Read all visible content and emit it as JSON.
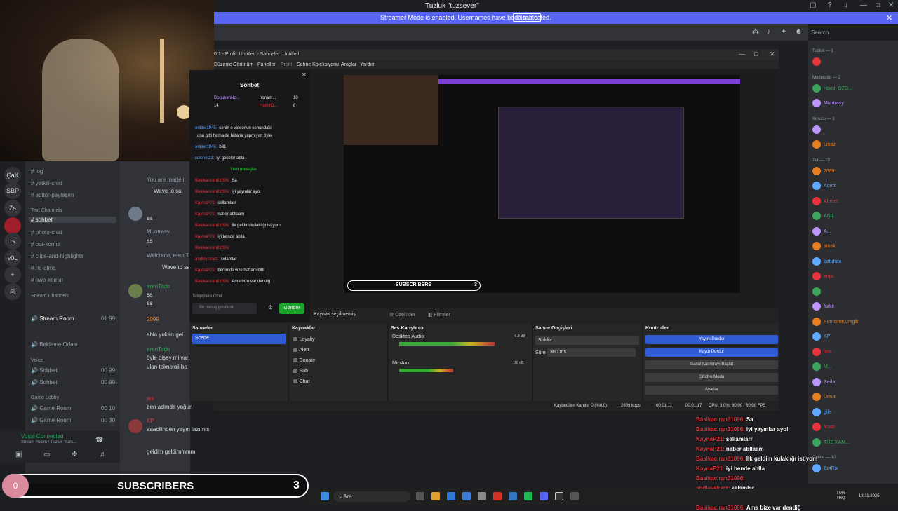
{
  "window": {
    "title": "Tuzluk \"tuzsever\""
  },
  "streamer_bar": {
    "message": "Streamer Mode is enabled. Usernames have been truncated.",
    "button": "Disable"
  },
  "search": {
    "placeholder": "Search"
  },
  "servers": [
    "ÇaK",
    "SBP",
    "Zs",
    "ts",
    "v0L"
  ],
  "channels": {
    "items_top": [
      "log",
      "yetkili-chat",
      "editör-paylaşım"
    ],
    "text_category": "Text Channels",
    "text_channels": [
      "sohbet",
      "photo-chat",
      "bot-komut",
      "clips-and-highlights",
      "rol-alma",
      "owo-komut"
    ],
    "stream_category": "Stream Channels",
    "stream_room": "Stream Room",
    "stream_room_counts": "01  99",
    "waiting_room": "Bekleme Odası",
    "voice_category": "Voice",
    "voice_channels": [
      "Sohbet",
      "Sohbet"
    ],
    "voice_counts": [
      "00  99",
      "00  99"
    ],
    "game_category": "Game Lobby",
    "game_rooms": [
      "Game Room",
      "Game Room"
    ],
    "game_counts": [
      "00  10",
      "00  30"
    ],
    "voice_connected": "Voice Connected",
    "voice_connected_sub": "Stream Room / Tuzluk \"tuzs..."
  },
  "discord_chat": [
    {
      "name": "",
      "text": "You are made it"
    },
    {
      "name": "",
      "text": "Wave to sa"
    },
    {
      "name": "",
      "text": "sa"
    },
    {
      "name": "Muntrasy",
      "text": "as"
    },
    {
      "name": "",
      "text": "Welcome, eren Ta"
    },
    {
      "name": "",
      "text": "Wave to sa"
    },
    {
      "name": "erenTado",
      "text": "sa"
    },
    {
      "name": "",
      "text": "as"
    },
    {
      "name": "2099",
      "text": "abla yukarı gel"
    },
    {
      "name": "erenTado",
      "text": "öyle bişey mi vardı"
    },
    {
      "name": "",
      "text": "ulan teknoloji ba"
    },
    {
      "name": "jes",
      "text": "ben aslında yoğun"
    },
    {
      "name": "KP",
      "text": "aaacilinden yayın lazımıs"
    },
    {
      "name": "",
      "text": "geldim geldimmmm"
    }
  ],
  "obs": {
    "title": "0.1 - Profil: Untitled - Sahneler: Untitled",
    "menu": [
      "Düzenle",
      "Görünüm",
      "Paneller",
      "Profil",
      "Sahne Koleksiyonu",
      "Araçlar",
      "Yardım"
    ],
    "no_source": "Kaynak seçilmemiş",
    "properties": "Özellikler",
    "filters": "Filtreler",
    "scenes_title": "Sahneler",
    "scenes": [
      "Scene"
    ],
    "sources_title": "Kaynaklar",
    "sources": [
      "Loyalty",
      "Alert",
      "Donate",
      "Sub",
      "Chat"
    ],
    "mixer_title": "Ses Karıştırıcı",
    "mixer": [
      {
        "name": "Desktop Audio",
        "db": "-6.8 dB",
        "level": 0.8
      },
      {
        "name": "Mic/Aux",
        "db": "0.0 dB",
        "level": 0.45
      }
    ],
    "transitions_title": "Sahne Geçişleri",
    "transition": "Soldur",
    "duration_label": "Süre",
    "duration": "300 ms",
    "controls_title": "Kontroller",
    "controls": [
      "Yayını Durdur",
      "Kaydı Durdur",
      "Sanal Kamerayı Başlat",
      "Stüdyo Modu",
      "Ayarlar"
    ],
    "status": {
      "dropped": "Kaybedilen Kareler 0 (%0.0)",
      "kbps": "2689 kbps",
      "rec": "00:01:11",
      "live": "00:01:17",
      "cpu": "CPU: 3.0%, 60.00 / 60.00 FPS"
    }
  },
  "twitch_chat": {
    "title": "Sohbet",
    "users": [
      "nonam...",
      "HamitO..."
    ],
    "counts": [
      "10",
      "8"
    ],
    "top_user": "DogukanNo...",
    "top_count": "14",
    "new_messages": "Yeni mesajlar",
    "lines": [
      {
        "user": "entine1945:",
        "text": "senin o videonun sonundaki",
        "cls": ""
      },
      {
        "user": "",
        "text": "una gitti herhalde bidaha yapmıyım öyle",
        "cls": ""
      },
      {
        "user": "entine1945:",
        "text": "b31",
        "cls": ""
      },
      {
        "user": "colonel22:",
        "text": "iyi geceler abla",
        "cls": ""
      },
      {
        "user": "Basikaciran31096:",
        "text": "Sa",
        "cls": "red"
      },
      {
        "user": "Basikaciran31096:",
        "text": "iyi yayınlar ayol",
        "cls": "red"
      },
      {
        "user": "KaynaP21:",
        "text": "sellamlarr",
        "cls": "red"
      },
      {
        "user": "KaynaP21:",
        "text": "naber abllaam",
        "cls": "red"
      },
      {
        "user": "Basikaciran31096:",
        "text": "İlk geldim kulaklığı istiyom",
        "cls": "red"
      },
      {
        "user": "KaynaP21:",
        "text": "iyi bende ablla",
        "cls": "red"
      },
      {
        "user": "Basikaciran31096:",
        "text": "",
        "cls": "red"
      },
      {
        "user": "andleyskarz:",
        "text": "selamlar",
        "cls": "red"
      },
      {
        "user": "KaynaP21:",
        "text": "benimde vize haftam bitti",
        "cls": "red"
      },
      {
        "user": "Basikaciran31096:",
        "text": "Ama bize var dendiğ",
        "cls": "red"
      }
    ],
    "followers": "Takipçilere Özel",
    "input_placeholder": "Bir mesaj gönderin",
    "send": "Gönder"
  },
  "members": {
    "groups": [
      {
        "title": "Tuzluk — 1",
        "names": [
          ""
        ]
      },
      {
        "title": "Moderatör — 2",
        "names": [
          "Hamit ÖZG...",
          "Muntrasy"
        ]
      },
      {
        "title": "Kurucu — 2",
        "names": [
          "",
          "Lmaz"
        ]
      },
      {
        "title": "Tur — 19",
        "names": [
          "2099",
          "Adem",
          "Ahmet",
          "ANIL",
          "A...",
          "atoski",
          "batuhan",
          "enjin",
          "",
          "furkii",
          "FırıncımKüregili",
          "KP",
          "lost",
          "M...",
          "Sedat",
          "Umut",
          "gile",
          "Yuso",
          "THE KAM..."
        ]
      },
      {
        "title": "Online — 12",
        "names": [
          "BotRix"
        ]
      }
    ]
  },
  "overlay_chat": [
    {
      "user": "Basikaciran31096:",
      "text": "Sa"
    },
    {
      "user": "Basikaciran31096:",
      "text": "iyi yayınlar ayol"
    },
    {
      "user": "KaynaP21:",
      "text": "sellamlarr"
    },
    {
      "user": "KaynaP21:",
      "text": "naber abllaam"
    },
    {
      "user": "Basikaciran31096:",
      "text": "İlk geldim kulaklığı istiyom"
    },
    {
      "user": "KaynaP21:",
      "text": "iyi bende ablla"
    },
    {
      "user": "Basikaciran31096:",
      "text": ""
    },
    {
      "user": "andleyskarz:",
      "text": "selamlar"
    },
    {
      "user": "KaynaP21:",
      "text": "benimde vize haftam bitti"
    },
    {
      "user": "Basikaciran31096:",
      "text": "Ama bize var dendiğ"
    }
  ],
  "subs_bar": {
    "left": "0",
    "label": "SUBSCRIBERS",
    "count": "3"
  },
  "taskbar": {
    "search": "Ara",
    "lang": "TUR\nTRQ",
    "date": "13.11.2025"
  },
  "colors": {
    "discord_blurple": "#5865f2",
    "obs_blue": "#2f5bd3",
    "twitch_red": "#e5343a"
  }
}
